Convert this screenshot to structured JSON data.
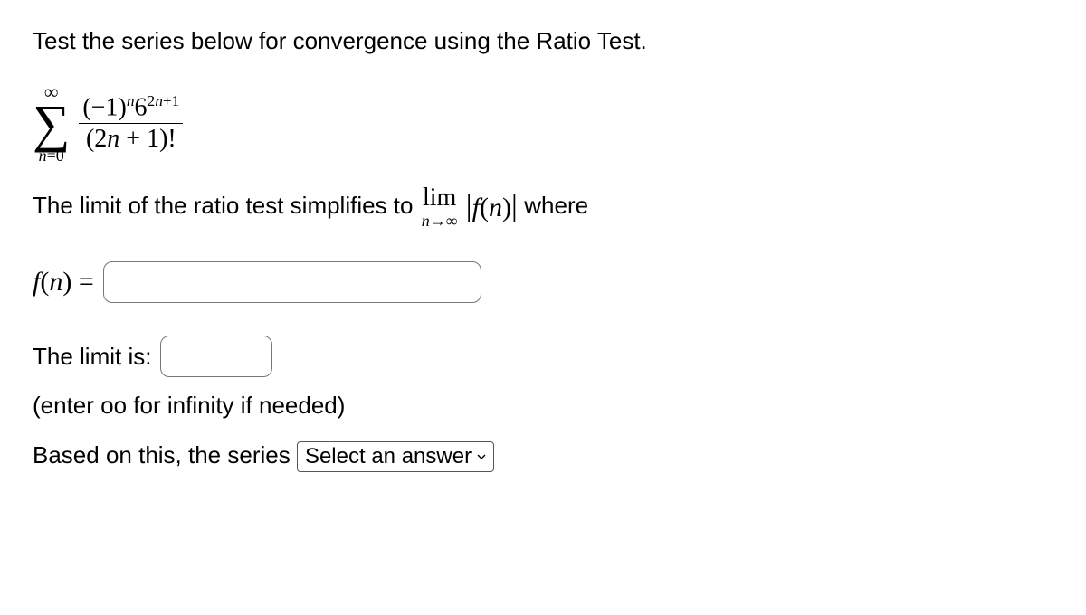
{
  "intro": "Test the series below for convergence using the Ratio Test.",
  "sum": {
    "upper": "∞",
    "lower_lhs": "n",
    "lower_eq": "=0",
    "numerator": {
      "base1": "(−1)",
      "exp1": "n",
      "base2": "6",
      "exp2_a": "2",
      "exp2_b": "n",
      "exp2_c": "+1"
    },
    "denominator": {
      "open": "(2",
      "var": "n",
      "close": " + 1)!"
    }
  },
  "ratio_sentence": {
    "before": "The limit of the ratio test simplifies to ",
    "lim": "lim",
    "sub_var": "n",
    "sub_rest": "→∞",
    "bar_open": "|",
    "f": "f",
    "paren_open": "(",
    "n": "n",
    "paren_close": ")",
    "bar_close": "|",
    "after": " where"
  },
  "fn_input": {
    "label_f": "f",
    "label_open": "(",
    "label_n": "n",
    "label_close": ") ="
  },
  "limit_input": {
    "label": "The limit is:",
    "hint": "(enter oo for infinity if needed)"
  },
  "conclusion": {
    "before": "Based on this, the series",
    "select_placeholder": "Select an answer"
  }
}
